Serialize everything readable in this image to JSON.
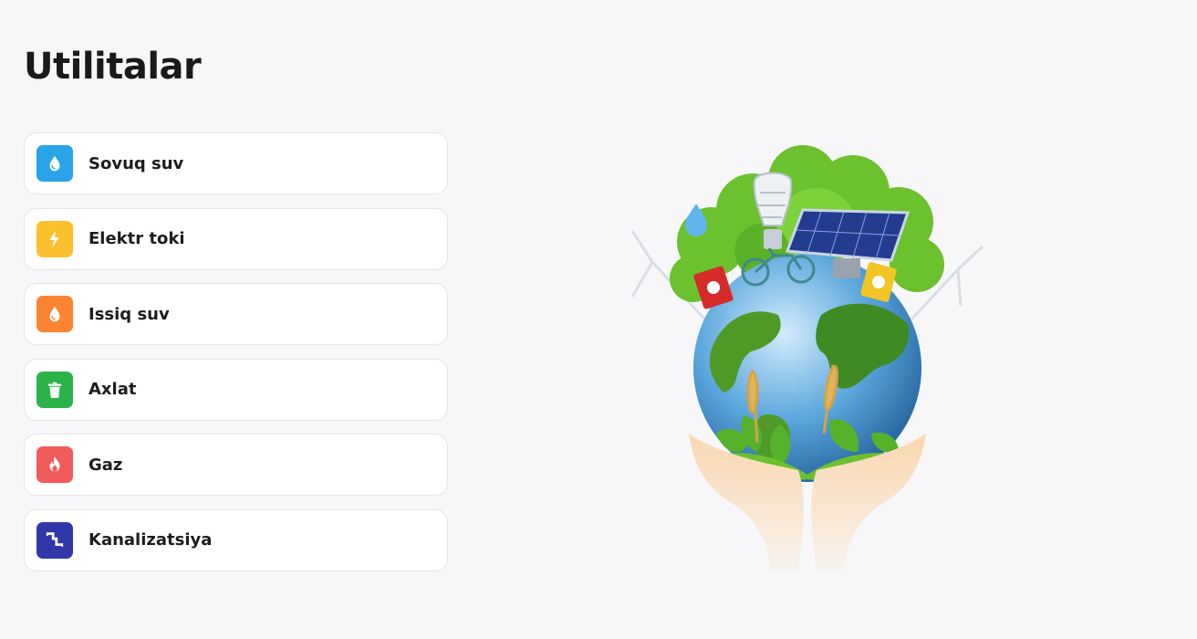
{
  "page": {
    "title": "Utilitalar"
  },
  "utilities": [
    {
      "label": "Sovuq suv",
      "icon": "water-drop-icon",
      "color": "#29a4e8"
    },
    {
      "label": "Elektr toki",
      "icon": "lightning-icon",
      "color": "#fcc02e"
    },
    {
      "label": "Issiq suv",
      "icon": "hot-water-drop-icon",
      "color": "#fb8432"
    },
    {
      "label": "Axlat",
      "icon": "trash-icon",
      "color": "#2bb34a"
    },
    {
      "label": "Gaz",
      "icon": "flame-icon",
      "color": "#f15b5b"
    },
    {
      "label": "Kanalizatsiya",
      "icon": "pipe-icon",
      "color": "#3038a8"
    }
  ],
  "illustration": {
    "icon": "eco-earth-hands-illustration"
  }
}
